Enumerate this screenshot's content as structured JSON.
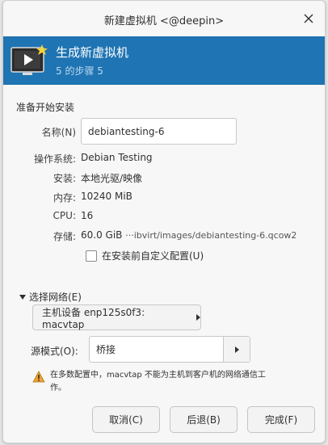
{
  "window": {
    "title": "新建虚拟机 <@deepin>"
  },
  "banner": {
    "title": "生成新虚拟机",
    "step": "5 的步骤 5"
  },
  "section": {
    "label": "准备开始安装"
  },
  "form": {
    "name_label": "名称(N)",
    "name_value": "debiantesting-6",
    "os_label": "操作系统:",
    "os_value": "Debian Testing",
    "install_label": "安装:",
    "install_value": "本地光驱/映像",
    "memory_label": "内存:",
    "memory_value": "10240 MiB",
    "cpu_label": "CPU:",
    "cpu_value": "16",
    "storage_label": "存储:",
    "storage_size": "60.0 GiB",
    "storage_path": "···ibvirt/images/debiantesting-6.qcow2",
    "customize_label": "在安装前自定义配置(U)"
  },
  "network": {
    "expander_label": "选择网络(E)",
    "host_device": "主机设备 enp125s0f3: macvtap",
    "source_mode_label": "源模式(O):",
    "source_mode_value": "桥接",
    "warning": "在多数配置中，macvtap 不能为主机到客户机的网络通信工作。"
  },
  "buttons": {
    "cancel": "取消(C)",
    "back": "后退(B)",
    "finish": "完成(F)"
  },
  "colors": {
    "banner": "#1f74b3",
    "warning": "#e8a33b"
  }
}
